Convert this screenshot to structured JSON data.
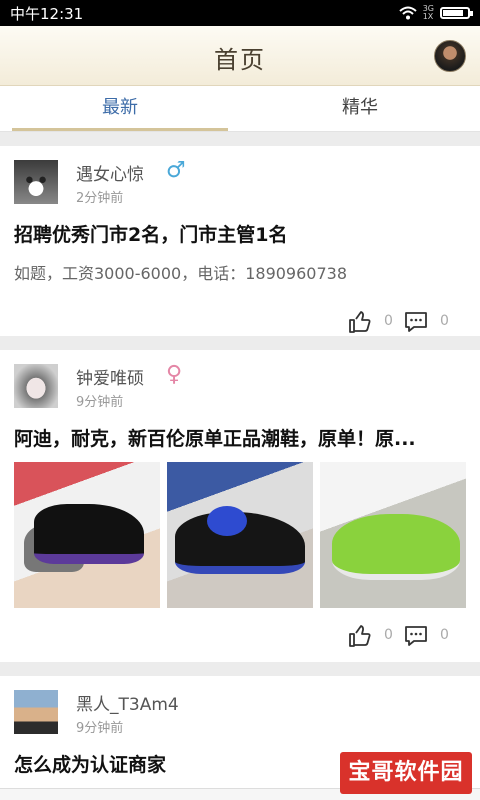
{
  "status_bar": {
    "time": "中午12:31",
    "network": "3G\n1X",
    "battery_level": 0.85
  },
  "header": {
    "title": "首页"
  },
  "tabs": [
    {
      "label": "最新",
      "active": true
    },
    {
      "label": "精华",
      "active": false
    }
  ],
  "posts": [
    {
      "author": "遇女心惊",
      "gender": "male",
      "gender_symbol": "♂",
      "time": "2分钟前",
      "title": "招聘优秀门市2名，门市主管1名",
      "body": "如题，工资3000-6000，电话：1890960738",
      "likes": "0",
      "comments": "0"
    },
    {
      "author": "钟爱唯硕",
      "gender": "female",
      "gender_symbol": "♀",
      "time": "9分钟前",
      "title": "阿迪，耐克，新百伦原单正品潮鞋，原单！原...",
      "likes": "0",
      "comments": "0",
      "photos": [
        "sneaker-photo-1",
        "sneaker-photo-2",
        "sneaker-photo-3"
      ]
    },
    {
      "author": "黑人_T3Am4",
      "time": "9分钟前",
      "title": "怎么成为认证商家"
    }
  ],
  "watermark": {
    "text": "宝哥软件园"
  },
  "colors": {
    "active_tab": "#3d6ca8",
    "male": "#4aa8d8",
    "female": "#e486a6",
    "header_bg": "#f3ecd9"
  }
}
